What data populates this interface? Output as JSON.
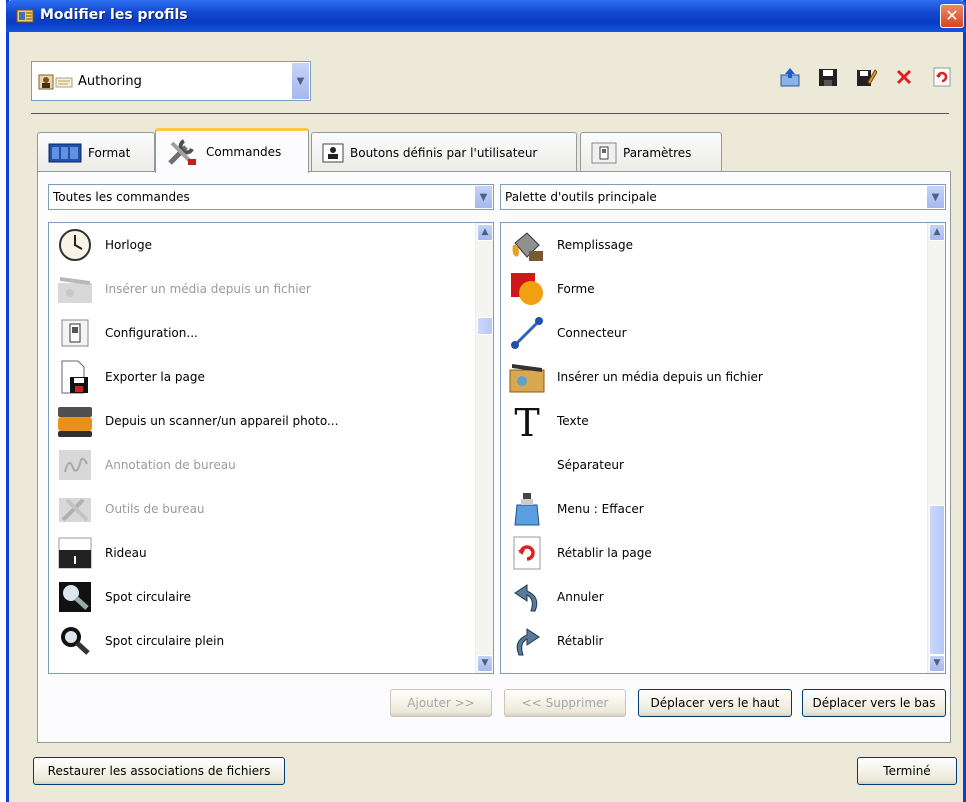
{
  "window": {
    "title": "Modifier les profils",
    "close_glyph": "✕"
  },
  "profile": {
    "value": "Authoring",
    "icon": "profile-icon"
  },
  "toolbar_icons": [
    "import-icon",
    "save-icon",
    "edit-icon",
    "delete-icon",
    "reset-icon"
  ],
  "tabs": [
    {
      "label": "Format",
      "icon": "format-icon"
    },
    {
      "label": "Commandes",
      "icon": "tools-icon"
    },
    {
      "label": "Boutons définis par l'utilisateur",
      "icon": "user-button-icon"
    },
    {
      "label": "Paramètres",
      "icon": "settings-icon"
    }
  ],
  "left": {
    "combo_value": "Toutes les commandes",
    "items": [
      {
        "label": "Horloge",
        "icon": "clock-icon",
        "enabled": true
      },
      {
        "label": "Insérer un média depuis un fichier",
        "icon": "media-icon",
        "enabled": false
      },
      {
        "label": "Configuration...",
        "icon": "config-icon",
        "enabled": true
      },
      {
        "label": "Exporter la page",
        "icon": "export-page-icon",
        "enabled": true
      },
      {
        "label": "Depuis un scanner/un appareil photo...",
        "icon": "scanner-icon",
        "enabled": true
      },
      {
        "label": "Annotation de bureau",
        "icon": "desktop-annotation-icon",
        "enabled": false
      },
      {
        "label": "Outils de bureau",
        "icon": "desktop-tools-icon",
        "enabled": false
      },
      {
        "label": "Rideau",
        "icon": "curtain-icon",
        "enabled": true
      },
      {
        "label": "Spot circulaire",
        "icon": "spotlight-icon",
        "enabled": true
      },
      {
        "label": "Spot circulaire plein",
        "icon": "spotlight-full-icon",
        "enabled": true
      }
    ]
  },
  "right": {
    "combo_value": "Palette d'outils principale",
    "items": [
      {
        "label": "Remplissage",
        "icon": "fill-icon"
      },
      {
        "label": "Forme",
        "icon": "shape-icon"
      },
      {
        "label": "Connecteur",
        "icon": "connector-icon"
      },
      {
        "label": "Insérer un média depuis un fichier",
        "icon": "media-icon"
      },
      {
        "label": "Texte",
        "icon": "text-icon"
      },
      {
        "label": "Séparateur",
        "icon": ""
      },
      {
        "label": "Menu : Effacer",
        "icon": "eraser-icon"
      },
      {
        "label": "Rétablir la page",
        "icon": "reset-page-icon"
      },
      {
        "label": "Annuler",
        "icon": "undo-icon"
      },
      {
        "label": "Rétablir",
        "icon": "redo-icon"
      }
    ]
  },
  "buttons": {
    "add": "Ajouter >>",
    "remove": "<< Supprimer",
    "move_up": "Déplacer vers le haut",
    "move_down": "Déplacer vers le bas",
    "restore": "Restaurer les associations de fichiers",
    "done": "Terminé"
  }
}
